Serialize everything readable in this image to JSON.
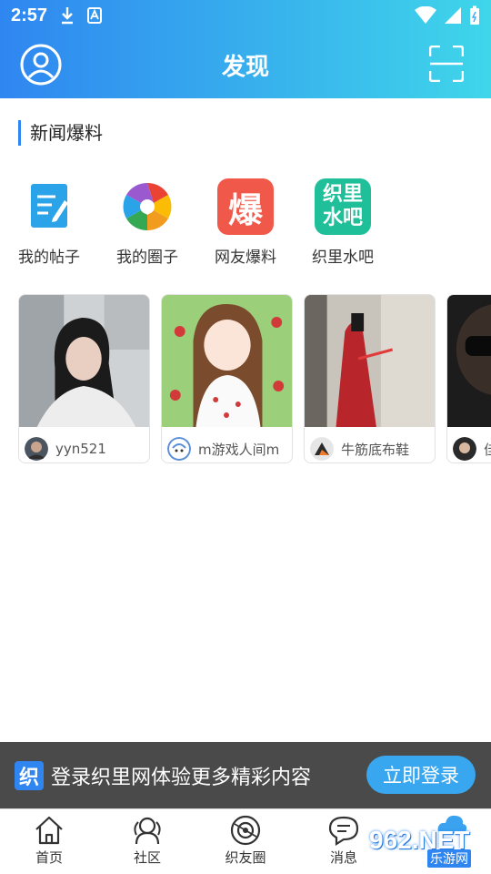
{
  "status_bar": {
    "time": "2:57"
  },
  "header": {
    "title": "发现"
  },
  "section": {
    "title": "新闻爆料"
  },
  "shortcuts": [
    {
      "label": "我的帖子",
      "icon": "note-pencil-icon"
    },
    {
      "label": "我的圈子",
      "icon": "aperture-icon"
    },
    {
      "label": "网友爆料",
      "icon": "bao-tile-icon",
      "tile_text": "爆",
      "color": "#f0584a"
    },
    {
      "label": "织里水吧",
      "icon": "zhili-shuiba-tile-icon",
      "tile_text": "织里 水吧",
      "color": "#1fbf9a"
    }
  ],
  "cards": [
    {
      "username": "yyn521"
    },
    {
      "username": "m游戏人间m"
    },
    {
      "username": "牛筋底布鞋"
    },
    {
      "username": "佳"
    }
  ],
  "login_bar": {
    "logo_text": "织",
    "text": "登录织里网体验更多精彩内容",
    "button_label": "立即登录"
  },
  "tabs": [
    {
      "label": "首页",
      "icon": "home-icon"
    },
    {
      "label": "社区",
      "icon": "community-icon"
    },
    {
      "label": "织友圈",
      "icon": "circle-icon"
    },
    {
      "label": "消息",
      "icon": "message-icon"
    }
  ],
  "watermark": {
    "top": "962.NET",
    "bottom": "乐游网"
  },
  "colors": {
    "accent": "#2f86f0",
    "accent_light": "#3fd6ea"
  }
}
